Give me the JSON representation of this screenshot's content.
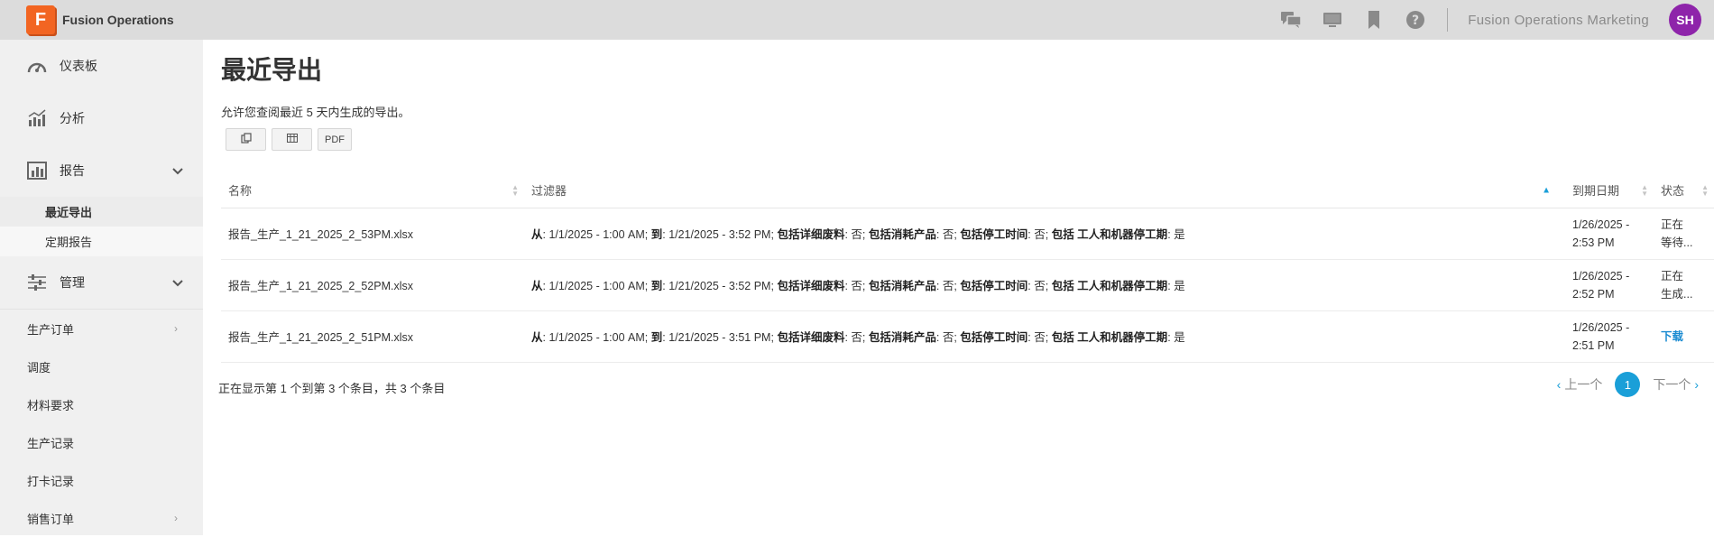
{
  "app": {
    "logo_letter": "F",
    "name": "Fusion Operations"
  },
  "header": {
    "org_name": "Fusion Operations Marketing",
    "avatar_initials": "SH",
    "icons": [
      "chat-icon",
      "monitor-icon",
      "bookmark-icon",
      "help-icon"
    ]
  },
  "sidebar": {
    "items": [
      {
        "label": "仪表板",
        "icon": "dashboard-icon"
      },
      {
        "label": "分析",
        "icon": "analytics-icon"
      },
      {
        "label": "报告",
        "icon": "report-icon"
      },
      {
        "label": "管理",
        "icon": "settings-sliders-icon"
      }
    ],
    "report_sub": [
      "最近导出",
      "定期报告"
    ],
    "plain_items": [
      "生产订单",
      "调度",
      "材料要求",
      "生产记录",
      "打卡记录",
      "销售订单"
    ]
  },
  "main": {
    "title": "最近导出",
    "description": "允许您查阅最近 5 天内生成的导出。",
    "buttons": {
      "pdf": "PDF"
    },
    "columns": [
      "名称",
      "过滤器",
      "到期日期",
      "状态"
    ],
    "rows": [
      {
        "name": "报告_生产_1_21_2025_2_53PM.xlsx",
        "to_date": "1/21/2025 - 3:52 PM",
        "date1": "1/26/2025 -",
        "date2": "2:53 PM",
        "status1": "正在",
        "status2": "等待..."
      },
      {
        "name": "报告_生产_1_21_2025_2_52PM.xlsx",
        "to_date": "1/21/2025 - 3:52 PM",
        "date1": "1/26/2025 -",
        "date2": "2:52 PM",
        "status1": "正在",
        "status2": "生成..."
      },
      {
        "name": "报告_生产_1_21_2025_2_51PM.xlsx",
        "to_date": "1/21/2025 - 3:51 PM",
        "date1": "1/26/2025 -",
        "date2": "2:51 PM",
        "status1": "下载",
        "status2": ""
      }
    ],
    "filter_labels": {
      "from": "从",
      "from_value": ": 1/1/2025 - 1:00 AM; ",
      "to": "到",
      "detail_scrap": "包括详细废料",
      "no1": ": 否; ",
      "consumables": "包括消耗产品",
      "no2": ": 否; ",
      "downtime": "包括停工时间",
      "no3": ": 否; ",
      "worker_machine": "包括 工人和机器停工期",
      "yes": ": 是"
    },
    "footer": "正在显示第 1 个到第 3 个条目，共 3 个条目",
    "pager": {
      "prev": "上一个",
      "page": "1",
      "next": "下一个"
    }
  }
}
